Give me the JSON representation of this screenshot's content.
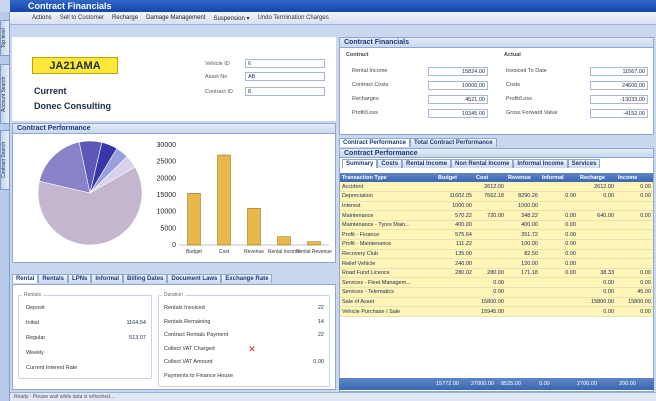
{
  "window": {
    "title": "Contract Financials"
  },
  "toolbar": [
    "Actions",
    "Sell to Customer",
    "Recharge",
    "Damage Management",
    "Suspension ▾",
    "Undo Termination Charges"
  ],
  "left_tabs": [
    "Top level",
    "Account Search",
    "Contract Search"
  ],
  "vehicle": {
    "plate": "JA21AMA",
    "status": "Current",
    "customer": "Donec Consulting",
    "fields": [
      {
        "label": "Vehicle ID",
        "value": "6"
      },
      {
        "label": "Asset No",
        "value": "AB"
      },
      {
        "label": "Contract ID",
        "value": "8"
      }
    ]
  },
  "contract_performance": {
    "title": "Contract Performance"
  },
  "chart_data": [
    {
      "type": "pie",
      "slices": [
        0.62,
        0.18,
        0.07,
        0.05,
        0.04,
        0.04
      ]
    },
    {
      "type": "bar",
      "categories": [
        "Budget",
        "Cost",
        "Revenue",
        "Rental Income",
        "Rental Revenue"
      ],
      "values": [
        15500,
        27000,
        11000,
        2500,
        1000
      ],
      "ylim": [
        0,
        30000
      ],
      "yticks": [
        "30000",
        "25000",
        "20000",
        "15000",
        "10000",
        "5000",
        "0"
      ]
    }
  ],
  "financials": {
    "title": "Contract Financials",
    "contract_heading": "Contract",
    "actual_heading": "Actual",
    "contract_rows": [
      {
        "label": "Rental Income",
        "value": "15824.00"
      },
      {
        "label": "Contract Costs",
        "value": "10000.00"
      },
      {
        "label": "Recharges",
        "value": "4521.00"
      },
      {
        "label": "Profit/Loss",
        "value": "10345.00"
      }
    ],
    "actual_rows": [
      {
        "label": "Invoiced To Date",
        "value": "11567.00"
      },
      {
        "label": "Costs",
        "value": "24600.00"
      },
      {
        "label": "Profit/Loss",
        "value": "-13033.00"
      },
      {
        "label": "Gross Forward Value",
        "value": "-4152.00"
      }
    ]
  },
  "perf_tabs": [
    "Contract Performance",
    "Total Contract Performance"
  ],
  "perf_title": "Contract Performance",
  "sub_tabs": [
    "Summary",
    "Costs",
    "Rental Income",
    "Non Rental Income",
    "Informal Income",
    "Services"
  ],
  "table": {
    "headers": [
      "Transaction Type",
      "Budget",
      "Cost",
      "Revenue",
      "Informal",
      "Recharge",
      "Income"
    ],
    "rows": [
      [
        "Accident",
        "",
        "2612.00",
        "",
        "",
        "2612.00",
        "0.00"
      ],
      [
        "Depreciation",
        "11602.05",
        "7662.18",
        "8290.26",
        "0.00",
        "0.00",
        "0.00"
      ],
      [
        "Interest",
        "1000.00",
        "",
        "1000.00",
        "",
        "",
        ""
      ],
      [
        "Maintenance",
        "570.22",
        "720.00",
        "348.22",
        "0.00",
        "640.00",
        "0.00"
      ],
      [
        "Maintenance - Tyres Main...",
        "400.00",
        "",
        "400.00",
        "0.00",
        "",
        ""
      ],
      [
        "Profit - Finance",
        "575.64",
        "",
        "351.72",
        "0.00",
        "",
        ""
      ],
      [
        "Profit - Maintenance",
        "111.22",
        "",
        "100.00",
        "0.00",
        "",
        ""
      ],
      [
        "Recovery Club",
        "135.00",
        "",
        "82.50",
        "0.00",
        "",
        ""
      ],
      [
        "Relief Vehicle",
        "240.00",
        "",
        "120.00",
        "0.00",
        "",
        ""
      ],
      [
        "Road Fund Licence",
        "280.02",
        "280.00",
        "171.18",
        "0.00",
        "38.33",
        "0.00"
      ],
      [
        "Services - Fleet Managem...",
        "",
        "0.00",
        "",
        "",
        "0.00",
        "0.00"
      ],
      [
        "Services - Telematics",
        "",
        "0.00",
        "",
        "",
        "0.00",
        "45.00"
      ],
      [
        "Sale of Asset",
        "",
        "15800.00",
        "",
        "",
        "15800.00",
        "15800.00"
      ],
      [
        "Vehicle Purchase / Sale",
        "",
        "15945.00",
        "",
        "",
        "0.00",
        "0.00"
      ]
    ],
    "totals": [
      "15772.00",
      "27000.00",
      "8525.00",
      "0.00",
      "2700.00",
      "200.00"
    ]
  },
  "lower_tabs": [
    "Rental",
    "Rentals",
    "LPNs",
    "Informal",
    "Billing Dates",
    "Document Laws",
    "Exchange Rate"
  ],
  "rentals_group": {
    "title": "Rentals",
    "rows": [
      {
        "label": "Deposit",
        "value": ""
      },
      {
        "label": "Initial",
        "value": "1164.54"
      },
      {
        "label": "Regular",
        "value": "513.07"
      },
      {
        "label": "Weekly",
        "value": ""
      },
      {
        "label": "Current Interest Rate",
        "value": ""
      }
    ]
  },
  "duration_group": {
    "title": "Duration",
    "rows": [
      {
        "label": "Rentals Invoiced",
        "value": "22"
      },
      {
        "label": "Rentals Remaining",
        "value": "14"
      },
      {
        "label": "Contract Rentals Payment",
        "value": "22"
      },
      {
        "label": "Collect VAT Charged",
        "value": "✕"
      },
      {
        "label": "Collect VAT Amount",
        "value": "0.00"
      },
      {
        "label": "Payments to Finance House",
        "value": ""
      }
    ]
  },
  "statusbar": "Ready · Please wait while data is refreshed...",
  "colors": {
    "accent": "#3b66b2",
    "plate": "#ffe83a",
    "row": "#fff5b8",
    "bar": "#e8b84a"
  }
}
